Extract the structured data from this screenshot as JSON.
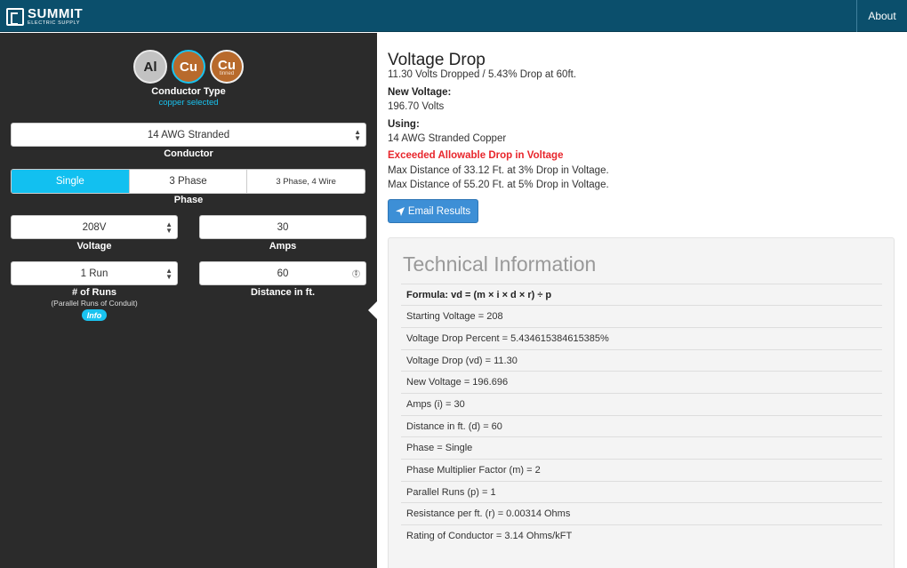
{
  "header": {
    "logo_main": "SUMMIT",
    "logo_sub": "ELECTRIC SUPPLY",
    "about_label": "About"
  },
  "conductor_type": {
    "options": [
      {
        "symbol": "Al",
        "sub": ""
      },
      {
        "symbol": "Cu",
        "sub": ""
      },
      {
        "symbol": "Cu",
        "sub": "tinned"
      }
    ],
    "label": "Conductor Type",
    "selected_text": "copper selected"
  },
  "conductor": {
    "value": "14 AWG Stranded",
    "label": "Conductor"
  },
  "phase": {
    "options": [
      "Single",
      "3 Phase",
      "3 Phase, 4 Wire"
    ],
    "active": "Single",
    "label": "Phase"
  },
  "voltage": {
    "value": "208V",
    "label": "Voltage"
  },
  "amps": {
    "value": "30",
    "label": "Amps"
  },
  "runs": {
    "value": "1 Run",
    "label": "# of Runs",
    "note": "(Parallel Runs of Conduit)",
    "info_label": "Info"
  },
  "distance": {
    "value": "60",
    "label": "Distance in ft."
  },
  "results": {
    "title": "Voltage Drop",
    "summary": "11.30 Volts Dropped / 5.43% Drop at 60ft.",
    "new_voltage_label": "New Voltage:",
    "new_voltage_value": "196.70 Volts",
    "using_label": "Using:",
    "using_value": "14 AWG Stranded Copper",
    "warning": "Exceeded Allowable Drop in Voltage",
    "max3": "Max Distance of 33.12 Ft. at 3% Drop in Voltage.",
    "max5": "Max Distance of 55.20 Ft. at 5% Drop in Voltage.",
    "email_label": "Email Results"
  },
  "technical": {
    "title": "Technical Information",
    "rows": [
      "Formula: vd = (m × i × d × r) ÷ p",
      "Starting Voltage = 208",
      "Voltage Drop Percent = 5.434615384615385%",
      "Voltage Drop (vd) = 11.30",
      "New Voltage = 196.696",
      "Amps (i) = 30",
      "Distance in ft. (d) = 60",
      "Phase = Single",
      "Phase Multiplier Factor (m) = 2",
      "Parallel Runs (p) = 1",
      "Resistance per ft. (r) = 0.00314 Ohms",
      "Rating of Conductor = 3.14 Ohms/kFT"
    ]
  }
}
